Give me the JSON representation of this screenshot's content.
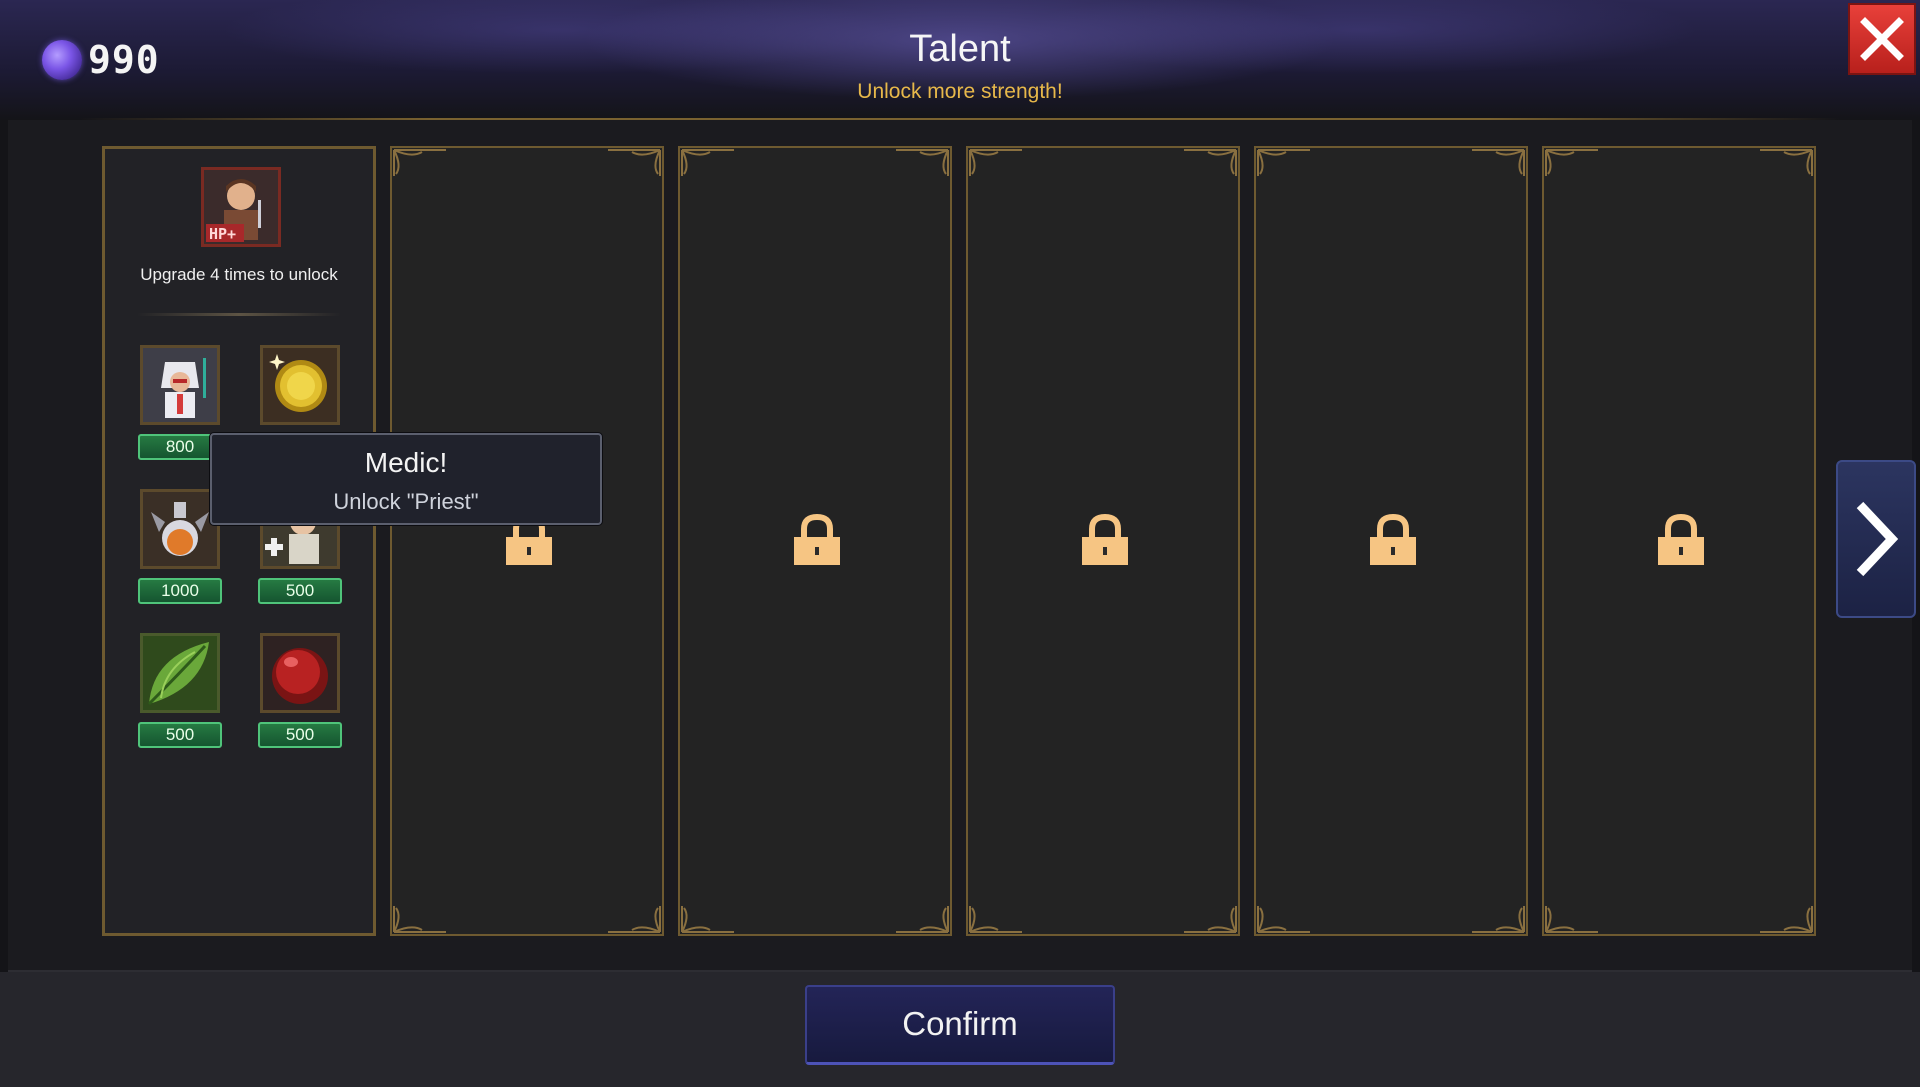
{
  "currency": {
    "icon": "soul-orb-icon",
    "value": "990"
  },
  "header": {
    "title": "Talent",
    "subtitle": "Unlock more strength!"
  },
  "left_panel": {
    "hero_icon": "hp-plus-hero-portrait-icon",
    "unlock_note": "Upgrade 4 times to unlock",
    "skills": [
      {
        "icon": "priest-hero-icon",
        "cost": "800"
      },
      {
        "icon": "gold-coin-icon",
        "cost": ""
      },
      {
        "icon": "potion-flask-icon",
        "cost": "1000"
      },
      {
        "icon": "medic-hero-icon",
        "cost": "500"
      },
      {
        "icon": "green-leaf-icon",
        "cost": "500"
      },
      {
        "icon": "red-orb-icon",
        "cost": "500"
      }
    ]
  },
  "tooltip": {
    "title": "Medic!",
    "body": "Unlock \"Priest\""
  },
  "slots": [
    {
      "state": "locked",
      "icon": "lock-icon"
    },
    {
      "state": "locked",
      "icon": "lock-icon"
    },
    {
      "state": "locked",
      "icon": "lock-icon"
    },
    {
      "state": "locked",
      "icon": "lock-icon"
    },
    {
      "state": "locked",
      "icon": "lock-icon"
    }
  ],
  "next_icon": "chevron-right-icon",
  "close_icon": "close-icon",
  "footer": {
    "confirm_label": "Confirm"
  },
  "colors": {
    "accent_gold": "#e7b84a",
    "frame_gold": "#6e5a30",
    "cost_green": "#267a42",
    "close_red": "#d03530",
    "lock_orange": "#f6c583",
    "button_navy": "#232457"
  }
}
